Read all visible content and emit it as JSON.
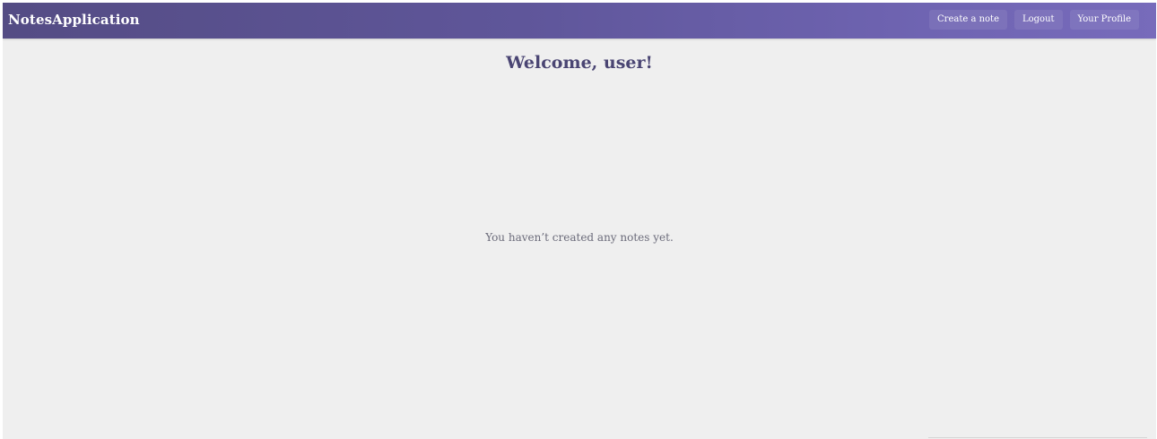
{
  "navbar": {
    "brand": "NotesApplication",
    "buttons": {
      "create_note": "Create a note",
      "logout": "Logout",
      "profile": "Your Profile"
    }
  },
  "main": {
    "welcome": "Welcome, user!",
    "empty_message": "You haven’t created any notes yet."
  },
  "colors": {
    "navbar_start": "#544c84",
    "navbar_end": "#776bbb",
    "background": "#efefef",
    "welcome_text": "#4a4573",
    "muted_text": "#6b6b7a"
  }
}
